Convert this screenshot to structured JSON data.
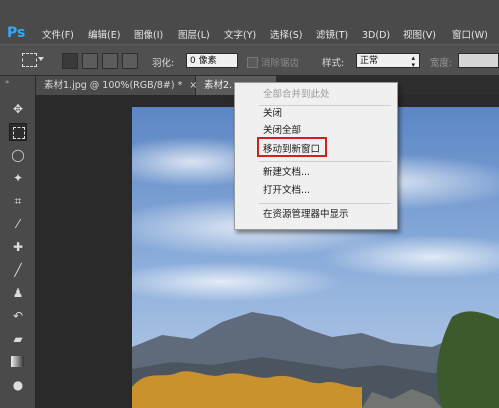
{
  "app": {
    "logo": "Ps"
  },
  "menu": {
    "items": [
      "文件(F)",
      "编辑(E)",
      "图像(I)",
      "图层(L)",
      "文字(Y)",
      "选择(S)",
      "滤镜(T)",
      "3D(D)",
      "视图(V)",
      "窗口(W)"
    ]
  },
  "options": {
    "feather_label": "羽化:",
    "feather_value": "0 像素",
    "antialias_label": "消除锯齿",
    "style_label": "样式:",
    "style_value": "正常",
    "width_label": "宽度:"
  },
  "tabs": [
    {
      "label": "素材1.jpg @ 100%(RGB/8#) *",
      "close": "×"
    },
    {
      "label": "素材2."
    }
  ],
  "context_menu": {
    "items": [
      {
        "label": "全部合并到此处",
        "disabled": true
      },
      {
        "label": "关闭"
      },
      {
        "label": "关闭全部"
      },
      {
        "label": "移动到新窗口",
        "highlighted": true
      },
      {
        "label": "新建文档..."
      },
      {
        "label": "打开文档..."
      },
      {
        "label": "在资源管理器中显示"
      }
    ]
  },
  "colors": {
    "highlight_border": "#d22020",
    "logo": "#36a6f5",
    "sky": "#7ea6d8"
  },
  "icons": [
    "marquee-icon",
    "move-icon",
    "lasso-icon",
    "magic-wand-icon",
    "crop-icon",
    "eyedropper-icon",
    "heal-icon",
    "brush-icon",
    "stamp-icon",
    "history-brush-icon",
    "eraser-icon",
    "gradient-icon",
    "blur-icon"
  ]
}
